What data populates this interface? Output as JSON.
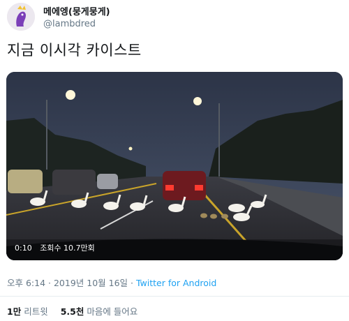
{
  "user": {
    "display_name": "메에엥(뭉게뭉게)",
    "handle": "@lambdred"
  },
  "tweet": {
    "text": "지금 이시각 카이스트"
  },
  "video": {
    "duration": "0:10",
    "views": "조회수 10.7만회"
  },
  "meta": {
    "timestamp": "오후 6:14 · 2019년 10월 16일",
    "separator": " · ",
    "source": "Twitter for Android"
  },
  "stats": {
    "retweets_count": "1만",
    "retweets_label": "리트윗",
    "likes_count": "5.5천",
    "likes_label": "마음에 들어요"
  },
  "colors": {
    "link": "#1da1f2",
    "muted": "#657786",
    "text": "#14171a"
  }
}
